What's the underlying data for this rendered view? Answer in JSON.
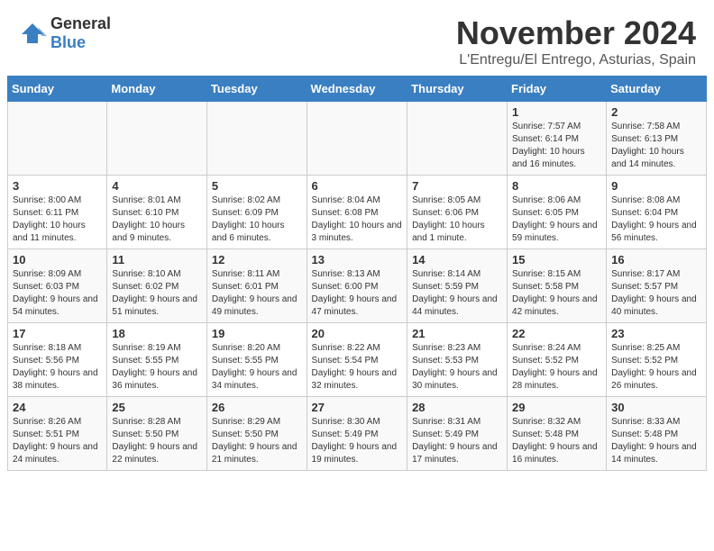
{
  "header": {
    "logo": {
      "general": "General",
      "blue": "Blue"
    },
    "title": "November 2024",
    "location": "L'Entregu/El Entrego, Asturias, Spain"
  },
  "calendar": {
    "days_of_week": [
      "Sunday",
      "Monday",
      "Tuesday",
      "Wednesday",
      "Thursday",
      "Friday",
      "Saturday"
    ],
    "weeks": [
      {
        "days": [
          {
            "number": "",
            "info": ""
          },
          {
            "number": "",
            "info": ""
          },
          {
            "number": "",
            "info": ""
          },
          {
            "number": "",
            "info": ""
          },
          {
            "number": "",
            "info": ""
          },
          {
            "number": "1",
            "info": "Sunrise: 7:57 AM\nSunset: 6:14 PM\nDaylight: 10 hours and 16 minutes."
          },
          {
            "number": "2",
            "info": "Sunrise: 7:58 AM\nSunset: 6:13 PM\nDaylight: 10 hours and 14 minutes."
          }
        ]
      },
      {
        "days": [
          {
            "number": "3",
            "info": "Sunrise: 8:00 AM\nSunset: 6:11 PM\nDaylight: 10 hours and 11 minutes."
          },
          {
            "number": "4",
            "info": "Sunrise: 8:01 AM\nSunset: 6:10 PM\nDaylight: 10 hours and 9 minutes."
          },
          {
            "number": "5",
            "info": "Sunrise: 8:02 AM\nSunset: 6:09 PM\nDaylight: 10 hours and 6 minutes."
          },
          {
            "number": "6",
            "info": "Sunrise: 8:04 AM\nSunset: 6:08 PM\nDaylight: 10 hours and 3 minutes."
          },
          {
            "number": "7",
            "info": "Sunrise: 8:05 AM\nSunset: 6:06 PM\nDaylight: 10 hours and 1 minute."
          },
          {
            "number": "8",
            "info": "Sunrise: 8:06 AM\nSunset: 6:05 PM\nDaylight: 9 hours and 59 minutes."
          },
          {
            "number": "9",
            "info": "Sunrise: 8:08 AM\nSunset: 6:04 PM\nDaylight: 9 hours and 56 minutes."
          }
        ]
      },
      {
        "days": [
          {
            "number": "10",
            "info": "Sunrise: 8:09 AM\nSunset: 6:03 PM\nDaylight: 9 hours and 54 minutes."
          },
          {
            "number": "11",
            "info": "Sunrise: 8:10 AM\nSunset: 6:02 PM\nDaylight: 9 hours and 51 minutes."
          },
          {
            "number": "12",
            "info": "Sunrise: 8:11 AM\nSunset: 6:01 PM\nDaylight: 9 hours and 49 minutes."
          },
          {
            "number": "13",
            "info": "Sunrise: 8:13 AM\nSunset: 6:00 PM\nDaylight: 9 hours and 47 minutes."
          },
          {
            "number": "14",
            "info": "Sunrise: 8:14 AM\nSunset: 5:59 PM\nDaylight: 9 hours and 44 minutes."
          },
          {
            "number": "15",
            "info": "Sunrise: 8:15 AM\nSunset: 5:58 PM\nDaylight: 9 hours and 42 minutes."
          },
          {
            "number": "16",
            "info": "Sunrise: 8:17 AM\nSunset: 5:57 PM\nDaylight: 9 hours and 40 minutes."
          }
        ]
      },
      {
        "days": [
          {
            "number": "17",
            "info": "Sunrise: 8:18 AM\nSunset: 5:56 PM\nDaylight: 9 hours and 38 minutes."
          },
          {
            "number": "18",
            "info": "Sunrise: 8:19 AM\nSunset: 5:55 PM\nDaylight: 9 hours and 36 minutes."
          },
          {
            "number": "19",
            "info": "Sunrise: 8:20 AM\nSunset: 5:55 PM\nDaylight: 9 hours and 34 minutes."
          },
          {
            "number": "20",
            "info": "Sunrise: 8:22 AM\nSunset: 5:54 PM\nDaylight: 9 hours and 32 minutes."
          },
          {
            "number": "21",
            "info": "Sunrise: 8:23 AM\nSunset: 5:53 PM\nDaylight: 9 hours and 30 minutes."
          },
          {
            "number": "22",
            "info": "Sunrise: 8:24 AM\nSunset: 5:52 PM\nDaylight: 9 hours and 28 minutes."
          },
          {
            "number": "23",
            "info": "Sunrise: 8:25 AM\nSunset: 5:52 PM\nDaylight: 9 hours and 26 minutes."
          }
        ]
      },
      {
        "days": [
          {
            "number": "24",
            "info": "Sunrise: 8:26 AM\nSunset: 5:51 PM\nDaylight: 9 hours and 24 minutes."
          },
          {
            "number": "25",
            "info": "Sunrise: 8:28 AM\nSunset: 5:50 PM\nDaylight: 9 hours and 22 minutes."
          },
          {
            "number": "26",
            "info": "Sunrise: 8:29 AM\nSunset: 5:50 PM\nDaylight: 9 hours and 21 minutes."
          },
          {
            "number": "27",
            "info": "Sunrise: 8:30 AM\nSunset: 5:49 PM\nDaylight: 9 hours and 19 minutes."
          },
          {
            "number": "28",
            "info": "Sunrise: 8:31 AM\nSunset: 5:49 PM\nDaylight: 9 hours and 17 minutes."
          },
          {
            "number": "29",
            "info": "Sunrise: 8:32 AM\nSunset: 5:48 PM\nDaylight: 9 hours and 16 minutes."
          },
          {
            "number": "30",
            "info": "Sunrise: 8:33 AM\nSunset: 5:48 PM\nDaylight: 9 hours and 14 minutes."
          }
        ]
      }
    ]
  }
}
